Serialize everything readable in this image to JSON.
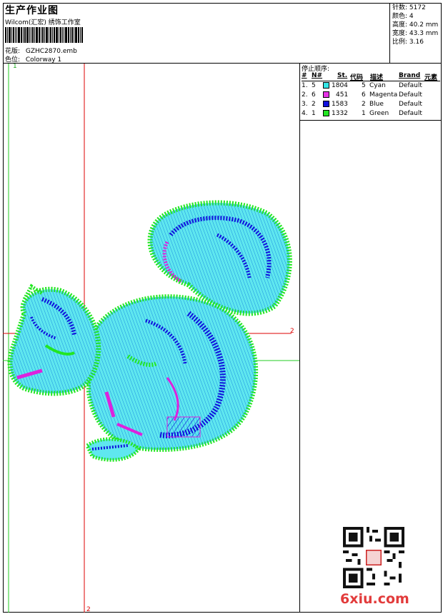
{
  "header": {
    "title": "生产作业图",
    "subtitle": "Wilcom(汇宏) 绣饰工作室",
    "design_label": "花版:",
    "design_value": "GZHC2870.emb",
    "colorway_label": "色位:",
    "colorway_value": "Colorway 1"
  },
  "stats": {
    "stitches": "针数: 5172",
    "colors": "颜色: 4",
    "height": "高度: 40.2 mm",
    "width": "宽度: 43.3 mm",
    "scale": "比例: 3.16"
  },
  "stop_sequence": {
    "heading": "停止顺序:",
    "columns": [
      "#",
      "N#",
      "St.",
      "代码",
      "描述",
      "Brand",
      "元素"
    ],
    "rows": [
      {
        "idx": "1.",
        "n": "5",
        "color": "#33e6e6",
        "st": "1804",
        "code": "5",
        "desc": "Cyan",
        "brand": "Default"
      },
      {
        "idx": "2.",
        "n": "6",
        "color": "#e633e6",
        "st": "451",
        "code": "6",
        "desc": "Magenta",
        "brand": "Default"
      },
      {
        "idx": "3.",
        "n": "2",
        "color": "#1010dd",
        "st": "1583",
        "code": "2",
        "desc": "Blue",
        "brand": "Default"
      },
      {
        "idx": "4.",
        "n": "1",
        "color": "#22e622",
        "st": "1332",
        "code": "1",
        "desc": "Green",
        "brand": "Default"
      }
    ]
  },
  "canvas": {
    "marker_top": "1",
    "marker_right": "2",
    "marker_bottom": "2"
  },
  "watermark": "6xiu.com"
}
